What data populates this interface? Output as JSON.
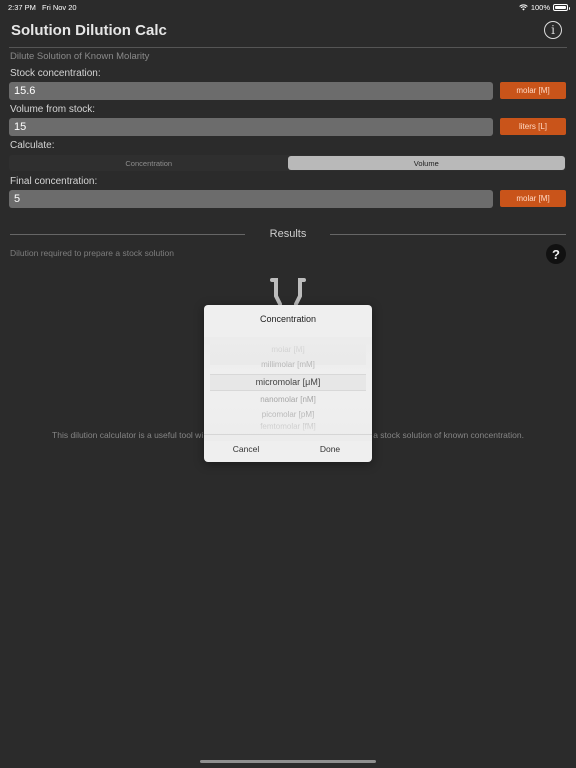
{
  "status_bar": {
    "time": "2:37 PM",
    "date": "Fri Nov 20",
    "battery": "100%"
  },
  "header": {
    "title": "Solution Dilution Calc",
    "subtitle": "Dilute Solution of Known Molarity"
  },
  "form": {
    "stock_concentration": {
      "label": "Stock concentration:",
      "value": "15.6",
      "unit": "molar [M]"
    },
    "volume_from_stock": {
      "label": "Volume from stock:",
      "value": "15",
      "unit": "liters [L]"
    },
    "calculate": {
      "label": "Calculate:",
      "options": [
        "Concentration",
        "Volume"
      ],
      "selected": "Volume"
    },
    "final_concentration": {
      "label": "Final concentration:",
      "value": "5",
      "unit": "molar [M]"
    }
  },
  "results": {
    "title": "Results",
    "subtitle": "Dilution required to prepare a stock solution",
    "description_left": "This dilution calculator is a useful tool wi",
    "description_right": "a stock solution of known concentration."
  },
  "picker_modal": {
    "title": "Concentration",
    "options": [
      "molar [M]",
      "millimolar [mM]",
      "micromolar [μM]",
      "nanomolar [nM]",
      "picomolar [pM]",
      "femtomolar [fM]"
    ],
    "selected": "micromolar [μM]",
    "cancel_label": "Cancel",
    "done_label": "Done"
  },
  "colors": {
    "background": "#2b2b2b",
    "accent": "#c9541a",
    "field": "#6c6c6c"
  },
  "icons": [
    "wifi-icon",
    "battery-icon",
    "info-icon",
    "help-icon",
    "flask-icon"
  ]
}
